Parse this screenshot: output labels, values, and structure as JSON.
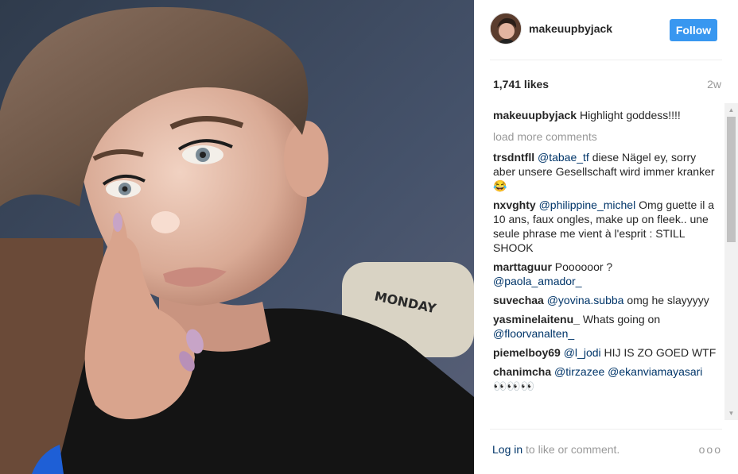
{
  "post": {
    "username": "makeuupbyjack",
    "follow_label": "Follow",
    "likes": "1,741 likes",
    "age": "2w"
  },
  "caption": {
    "user": "makeuupbyjack",
    "text": " Highlight goddess!!!!"
  },
  "load_more": "load more comments",
  "comments": [
    {
      "user": "trsdntfll",
      "mention": "@tabae_tf",
      "text": " diese Nägel ey, sorry aber unsere Gesellschaft wird immer kranker 😂"
    },
    {
      "user": "nxvghty",
      "mention": "@philippine_michel",
      "text": " Omg guette il a 10 ans, faux ongles, make up on fleek.. une seule phrase me vient à l'esprit : STILL SHOOK"
    },
    {
      "user": "marttaguur",
      "mention": "",
      "text": " Poooooor ?"
    },
    {
      "user": "suvechaa",
      "mention": "@yovina.subba",
      "text": " omg he slayyyyy"
    },
    {
      "user": "yasminelaitenu_",
      "mention": "",
      "text": " Whats going on"
    },
    {
      "user": "piemelboy69",
      "mention": "@l_jodi",
      "text": " HIJ IS ZO GOED WTF"
    },
    {
      "user": "chanimcha",
      "mention": "@tirzazee @ekanviamayasari",
      "text": " 👀👀👀"
    }
  ],
  "comment_extra": {
    "marttaguur_mention": "@paola_amador_",
    "yasmine_mention": "@floorvanalten_"
  },
  "footer": {
    "login_link": "Log in",
    "login_rest": " to like or comment.",
    "more_icon": "ooo"
  },
  "colors": {
    "follow_bg": "#3897f0",
    "mention": "#003569",
    "muted": "#999999"
  },
  "icons": {
    "more": "more-options-icon",
    "scroll_up": "scroll-up-icon",
    "scroll_down": "scroll-down-icon"
  }
}
